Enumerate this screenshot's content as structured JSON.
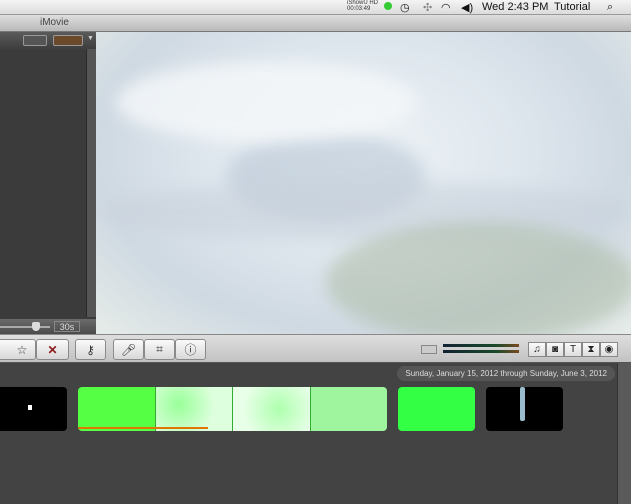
{
  "menubar": {
    "recorder": "iShowU HD",
    "recorder_time": "00:03:49",
    "datetime": "Wed 2:43 PM",
    "user": "Tutorial",
    "icons": [
      "time-machine-icon",
      "bluetooth-icon",
      "wifi-icon",
      "volume-icon",
      "spotlight-icon"
    ]
  },
  "window": {
    "title": "iMovie"
  },
  "left_panel": {
    "zoom_label": "30s",
    "zoom_level": 0.65
  },
  "toolbar": {
    "buttons": [
      "star-icon",
      "reject-icon",
      "keyword-icon",
      "voiceover-icon",
      "crop-icon",
      "info-icon"
    ],
    "browsers": [
      "music-icon",
      "photo-icon",
      "title-icon",
      "transition-icon",
      "map-icon"
    ]
  },
  "events": {
    "date_range": "Sunday, January 15, 2012 through Sunday, June 3, 2012"
  },
  "colors": {
    "green": "#44ff44",
    "selection": "#e07800"
  }
}
